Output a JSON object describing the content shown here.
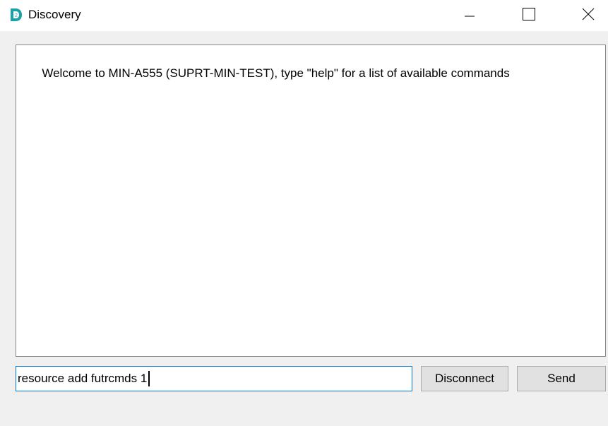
{
  "window": {
    "title": "Discovery",
    "app_icon": "discovery-d2-logo",
    "accent_color": "#1ba1a8"
  },
  "titlebar_buttons": {
    "minimize_icon": "minimize-icon",
    "maximize_icon": "maximize-icon",
    "close_icon": "close-icon"
  },
  "output": {
    "text": "Welcome to MIN-A555 (SUPRT-MIN-TEST), type \"help\" for a list of available commands"
  },
  "command": {
    "value": "resource add futrcmds 1"
  },
  "buttons": {
    "disconnect_label": "Disconnect",
    "send_label": "Send"
  }
}
